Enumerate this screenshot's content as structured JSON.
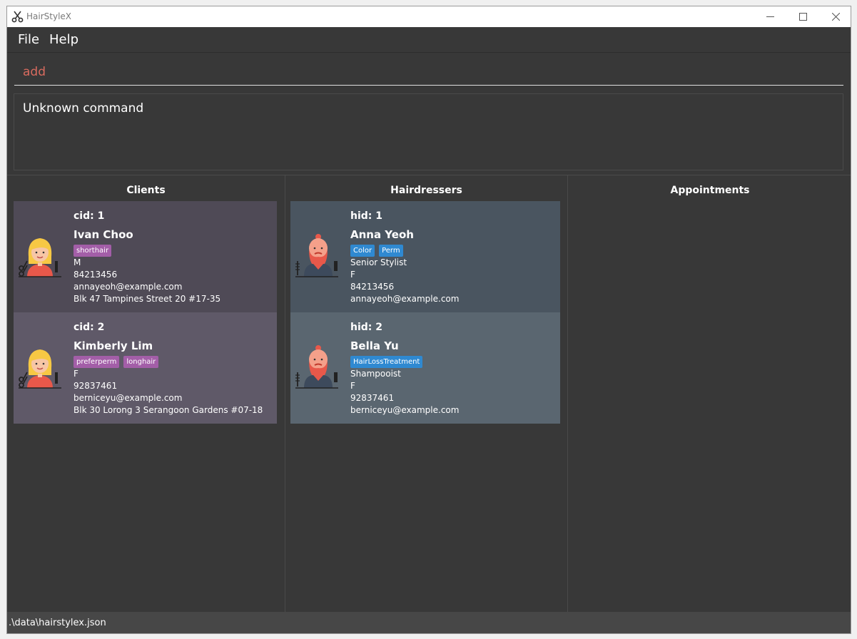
{
  "window": {
    "title": "HairStyleX"
  },
  "menu": {
    "file": "File",
    "help": "Help"
  },
  "command": {
    "value": "add"
  },
  "result": {
    "text": "Unknown command"
  },
  "panels": {
    "clients": "Clients",
    "hairdressers": "Hairdressers",
    "appointments": "Appointments"
  },
  "clients": [
    {
      "id": "cid: 1",
      "name": "Ivan Choo",
      "tags": [
        "shorthair"
      ],
      "gender": "M",
      "phone": "84213456",
      "email": "annayeoh@example.com",
      "address": "Blk 47 Tampines Street 20 #17-35"
    },
    {
      "id": "cid: 2",
      "name": "Kimberly Lim",
      "tags": [
        "preferperm",
        "longhair"
      ],
      "gender": "F",
      "phone": "92837461",
      "email": "berniceyu@example.com",
      "address": "Blk 30 Lorong 3 Serangoon Gardens #07-18"
    }
  ],
  "hairdressers": [
    {
      "id": "hid: 1",
      "name": "Anna Yeoh",
      "tags": [
        "Color",
        "Perm"
      ],
      "title": "Senior Stylist",
      "gender": "F",
      "phone": "84213456",
      "email": "annayeoh@example.com"
    },
    {
      "id": "hid: 2",
      "name": "Bella Yu",
      "tags": [
        "HairLossTreatment"
      ],
      "title": "Shampooist",
      "gender": "F",
      "phone": "92837461",
      "email": "berniceyu@example.com"
    }
  ],
  "status": {
    "path": ".\\data\\hairstylex.json"
  },
  "colors": {
    "client_tag": "#a35ea8",
    "hairdresser_tag": "#2f89d1",
    "client_card_1": "#4f4a56",
    "client_card_2": "#5f5968",
    "hairdresser_card_1": "#4a5560",
    "hairdresser_card_2": "#5a6670"
  },
  "icons": {
    "client": "hairdresser-woman-icon",
    "hairdresser": "bearded-barber-icon"
  }
}
